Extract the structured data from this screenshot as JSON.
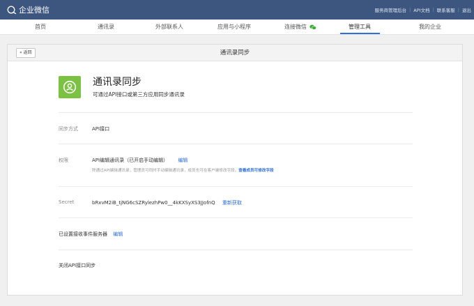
{
  "topbar": {
    "logo_text": "企业微信",
    "links": [
      "服务商管理后台",
      "API文档",
      "联系客服",
      "退出"
    ]
  },
  "nav": {
    "items": [
      "首页",
      "通讯录",
      "外部联系人",
      "应用与小程序",
      "连接微信",
      "管理工具",
      "我的企业"
    ],
    "active": "管理工具"
  },
  "panel": {
    "back_label": "« 返回",
    "title": "通讯录同步"
  },
  "app": {
    "name": "通讯录同步",
    "description": "可通过API接口或第三方应用同步通讯录"
  },
  "sync_method": {
    "label": "同步方式",
    "value": "API接口"
  },
  "permission": {
    "label": "权限",
    "value": "API编辑通讯录（已开启手动编辑）",
    "edit_link": "编辑",
    "note": "除通过API编辑通讯录，管理员可同时手动编辑通讯录，成员也可在客户端修改字段。",
    "note_link": "查看成员可修改字段"
  },
  "secret": {
    "label": "Secret",
    "value": "bRxvM2iB_tjNG6cSZRylezhPw0__4kKXSyXS3JJofnQ",
    "refresh_link": "重新获取"
  },
  "event_server": {
    "text": "已设置接收事件服务器",
    "edit_link": "编辑"
  },
  "close_api": {
    "text": "关闭API接口同步"
  },
  "colors": {
    "topbar": "#3c5680",
    "accent": "#2e6fd8",
    "app_icon": "#7bc243"
  }
}
